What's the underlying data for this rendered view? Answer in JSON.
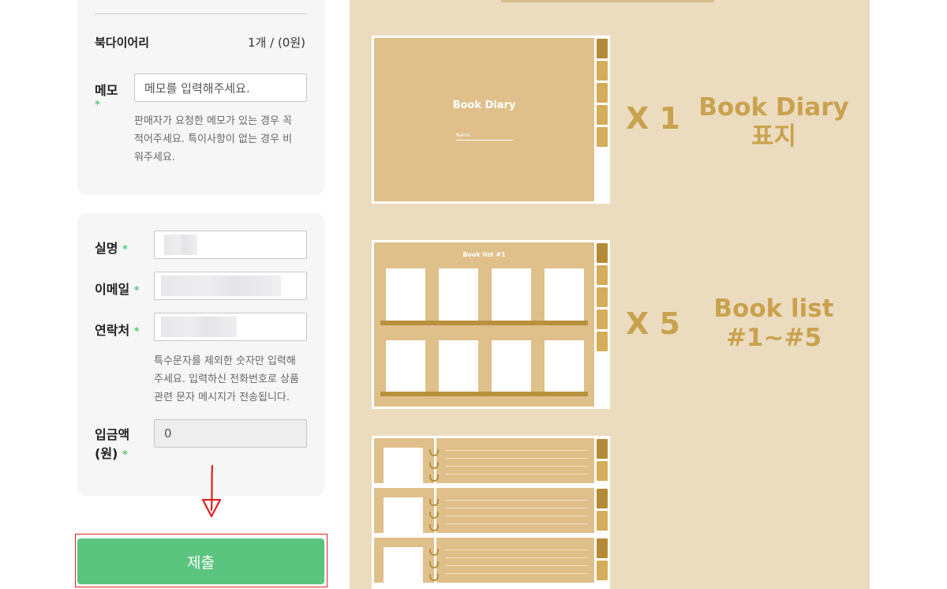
{
  "order": {
    "product_name": "북다이어리",
    "product_qty": "1개 / (0원)"
  },
  "memo": {
    "label": "메모",
    "required_mark": "*",
    "placeholder": "메모를 입력해주세요.",
    "help_lines": [
      "판매자가 요청한 메모가 있는 경우 꼭",
      "적어주세요. 특이사항이 없는 경우 비",
      "워주세요."
    ]
  },
  "contact": {
    "name_label": "실명",
    "email_label": "이메일",
    "phone_label": "연락처",
    "required_mark": "*",
    "phone_help_lines": [
      "특수문자를 제외한 숫자만 입력해",
      "주세요. 입력하신 전화번호로 상품",
      "관련 문자 메시지가 전송됩니다."
    ],
    "deposit_label_line1": "입금액",
    "deposit_label_line2": "(원)",
    "deposit_value": "0"
  },
  "submit": {
    "label": "제출"
  },
  "preview": {
    "cover": {
      "title": "Book Diary",
      "name_label": "Name",
      "multiplier": "X 1",
      "caption_line1": "Book Diary",
      "caption_line2": "표지"
    },
    "list": {
      "title": "Book list #1",
      "multiplier": "X 5",
      "caption_line1": "Book list",
      "caption_line2": "#1~#5"
    }
  },
  "colors": {
    "accent_green": "#5bc47f",
    "annotation_red": "#e02020",
    "preview_bg": "#ecdcbf",
    "gold_text": "#c9a24f"
  },
  "icons": {
    "annotation": "red-down-arrow"
  }
}
